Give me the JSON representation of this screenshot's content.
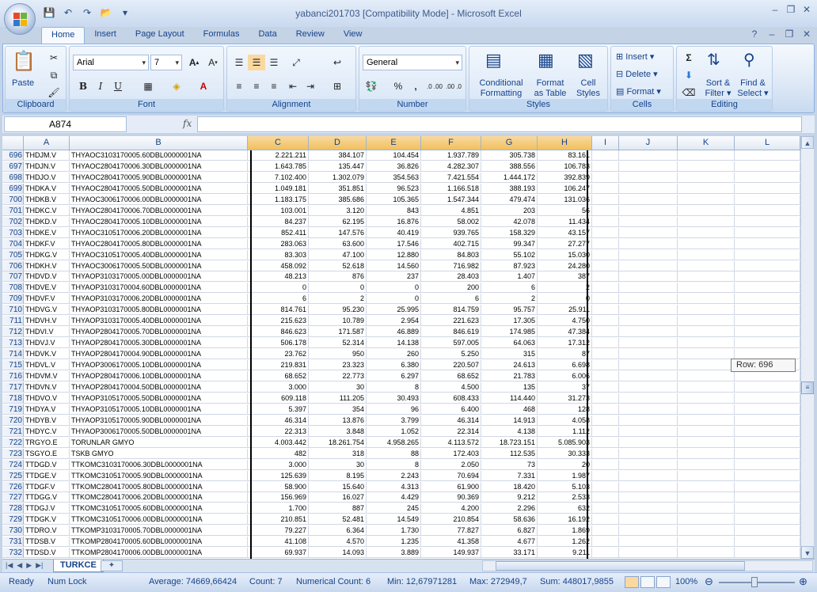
{
  "window": {
    "title": "yabanci201703  [Compatibility Mode] - Microsoft Excel",
    "controls": [
      "–",
      "❐",
      "✕"
    ]
  },
  "ribbon_tabs": [
    "Home",
    "Insert",
    "Page Layout",
    "Formulas",
    "Data",
    "Review",
    "View"
  ],
  "ribbon": {
    "clipboard": {
      "label": "Clipboard",
      "paste": "Paste"
    },
    "font": {
      "label": "Font",
      "name": "Arial",
      "size": "7",
      "bold": "B",
      "italic": "I",
      "underline": "U"
    },
    "alignment": {
      "label": "Alignment"
    },
    "number": {
      "label": "Number",
      "format": "General",
      "percent": "%",
      "comma": ",",
      "inc_dec": ".0 .00",
      "dec_dec": ".00 .0"
    },
    "styles": {
      "label": "Styles",
      "conditional": "Conditional",
      "conditional2": "Formatting",
      "format_table": "Format",
      "format_table2": "as Table",
      "cell_styles": "Cell",
      "cell_styles2": "Styles"
    },
    "cells": {
      "label": "Cells",
      "insert": "Insert",
      "delete": "Delete",
      "format": "Format"
    },
    "editing": {
      "label": "Editing",
      "sort": "Sort &",
      "sort2": "Filter",
      "find": "Find &",
      "find2": "Select"
    }
  },
  "formula_bar": {
    "name_box": "A874",
    "fx": "fx",
    "value": ""
  },
  "columns": [
    "A",
    "B",
    "C",
    "D",
    "E",
    "F",
    "G",
    "H",
    "I",
    "J",
    "K",
    "L"
  ],
  "rows": [
    {
      "n": "696",
      "a": "THDJM.V",
      "b": "THYAOC3103170005.60DBL0000001NA",
      "c": "2.221.211",
      "d": "384.107",
      "e": "104.454",
      "f": "1.937.789",
      "g": "305.738",
      "h": "83.161"
    },
    {
      "n": "697",
      "a": "THDJN.V",
      "b": "THYAOC2804170006.30DBL0000001NA",
      "c": "1.643.785",
      "d": "135.447",
      "e": "36.826",
      "f": "4.282.307",
      "g": "388.556",
      "h": "106.783"
    },
    {
      "n": "698",
      "a": "THDJO.V",
      "b": "THYAOC2804170005.90DBL0000001NA",
      "c": "7.102.400",
      "d": "1.302.079",
      "e": "354.563",
      "f": "7.421.554",
      "g": "1.444.172",
      "h": "392.839"
    },
    {
      "n": "699",
      "a": "THDKA.V",
      "b": "THYAOC2804170005.50DBL0000001NA",
      "c": "1.049.181",
      "d": "351.851",
      "e": "96.523",
      "f": "1.166.518",
      "g": "388.193",
      "h": "106.247"
    },
    {
      "n": "700",
      "a": "THDKB.V",
      "b": "THYAOC3006170006.00DBL0000001NA",
      "c": "1.183.175",
      "d": "385.686",
      "e": "105.365",
      "f": "1.547.344",
      "g": "479.474",
      "h": "131.036"
    },
    {
      "n": "701",
      "a": "THDKC.V",
      "b": "THYAOC2804170006.70DBL0000001NA",
      "c": "103.001",
      "d": "3.120",
      "e": "843",
      "f": "4.851",
      "g": "203",
      "h": "56"
    },
    {
      "n": "702",
      "a": "THDKD.V",
      "b": "THYAOC2804170005.10DBL0000001NA",
      "c": "84.237",
      "d": "62.195",
      "e": "16.876",
      "f": "58.002",
      "g": "42.078",
      "h": "11.434"
    },
    {
      "n": "703",
      "a": "THDKE.V",
      "b": "THYAOC3105170006.20DBL0000001NA",
      "c": "852.411",
      "d": "147.576",
      "e": "40.419",
      "f": "939.765",
      "g": "158.329",
      "h": "43.157"
    },
    {
      "n": "704",
      "a": "THDKF.V",
      "b": "THYAOC2804170005.80DBL0000001NA",
      "c": "283.063",
      "d": "63.600",
      "e": "17.546",
      "f": "402.715",
      "g": "99.347",
      "h": "27.277"
    },
    {
      "n": "705",
      "a": "THDKG.V",
      "b": "THYAOC3105170005.40DBL0000001NA",
      "c": "83.303",
      "d": "47.100",
      "e": "12.880",
      "f": "84.803",
      "g": "55.102",
      "h": "15.030"
    },
    {
      "n": "706",
      "a": "THDKH.V",
      "b": "THYAOC3006170005.50DBL0000001NA",
      "c": "458.092",
      "d": "52.618",
      "e": "14.560",
      "f": "716.982",
      "g": "87.923",
      "h": "24.280"
    },
    {
      "n": "707",
      "a": "THDVD.V",
      "b": "THYAOP3103170005.00DBL0000001NA",
      "c": "48.213",
      "d": "876",
      "e": "237",
      "f": "28.403",
      "g": "1.407",
      "h": "387"
    },
    {
      "n": "708",
      "a": "THDVE.V",
      "b": "THYAOP3103170004.60DBL0000001NA",
      "c": "0",
      "d": "0",
      "e": "0",
      "f": "200",
      "g": "6",
      "h": "2"
    },
    {
      "n": "709",
      "a": "THDVF.V",
      "b": "THYAOP3103170006.20DBL0000001NA",
      "c": "6",
      "d": "2",
      "e": "0",
      "f": "6",
      "g": "2",
      "h": "0"
    },
    {
      "n": "710",
      "a": "THDVG.V",
      "b": "THYAOP3103170005.80DBL0000001NA",
      "c": "814.761",
      "d": "95.230",
      "e": "25.995",
      "f": "814.759",
      "g": "95.757",
      "h": "25.911"
    },
    {
      "n": "711",
      "a": "THDVH.V",
      "b": "THYAOP3103170005.40DBL0000001NA",
      "c": "215.623",
      "d": "10.789",
      "e": "2.954",
      "f": "221.623",
      "g": "17.305",
      "h": "4.750"
    },
    {
      "n": "712",
      "a": "THDVI.V",
      "b": "THYAOP2804170005.70DBL0000001NA",
      "c": "846.623",
      "d": "171.587",
      "e": "46.889",
      "f": "846.619",
      "g": "174.985",
      "h": "47.384"
    },
    {
      "n": "713",
      "a": "THDVJ.V",
      "b": "THYAOP2804170005.30DBL0000001NA",
      "c": "506.178",
      "d": "52.314",
      "e": "14.138",
      "f": "597.005",
      "g": "64.063",
      "h": "17.312"
    },
    {
      "n": "714",
      "a": "THDVK.V",
      "b": "THYAOP2804170004.90DBL0000001NA",
      "c": "23.762",
      "d": "950",
      "e": "260",
      "f": "5.250",
      "g": "315",
      "h": "87"
    },
    {
      "n": "715",
      "a": "THDVL.V",
      "b": "THYAOP3006170005.10DBL0000001NA",
      "c": "219.831",
      "d": "23.323",
      "e": "6.380",
      "f": "220.507",
      "g": "24.613",
      "h": "6.698"
    },
    {
      "n": "716",
      "a": "THDVM.V",
      "b": "THYAOP2804170006.10DBL0000001NA",
      "c": "68.652",
      "d": "22.773",
      "e": "6.297",
      "f": "68.652",
      "g": "21.783",
      "h": "6.006"
    },
    {
      "n": "717",
      "a": "THDVN.V",
      "b": "THYAOP2804170004.50DBL0000001NA",
      "c": "3.000",
      "d": "30",
      "e": "8",
      "f": "4.500",
      "g": "135",
      "h": "37"
    },
    {
      "n": "718",
      "a": "THDVO.V",
      "b": "THYAOP3105170005.50DBL0000001NA",
      "c": "609.118",
      "d": "111.205",
      "e": "30.493",
      "f": "608.433",
      "g": "114.440",
      "h": "31.273"
    },
    {
      "n": "719",
      "a": "THDYA.V",
      "b": "THYAOP3105170005.10DBL0000001NA",
      "c": "5.397",
      "d": "354",
      "e": "96",
      "f": "6.400",
      "g": "468",
      "h": "128"
    },
    {
      "n": "720",
      "a": "THDYB.V",
      "b": "THYAOP3105170005.90DBL0000001NA",
      "c": "46.314",
      "d": "13.876",
      "e": "3.799",
      "f": "46.314",
      "g": "14.913",
      "h": "4.058"
    },
    {
      "n": "721",
      "a": "THDYC.V",
      "b": "THYAOP3006170005.50DBL0000001NA",
      "c": "22.313",
      "d": "3.848",
      "e": "1.052",
      "f": "22.314",
      "g": "4.138",
      "h": "1.112"
    },
    {
      "n": "722",
      "a": "TRGYO.E",
      "b": "TORUNLAR GMYO",
      "c": "4.003.442",
      "d": "18.261.754",
      "e": "4.958.265",
      "f": "4.113.572",
      "g": "18.723.151",
      "h": "5.085.903"
    },
    {
      "n": "723",
      "a": "TSGYO.E",
      "b": "TSKB GMYO",
      "c": "482",
      "d": "318",
      "e": "88",
      "f": "172.403",
      "g": "112.535",
      "h": "30.333"
    },
    {
      "n": "724",
      "a": "TTDGD.V",
      "b": "TTKOMC3103170006.30DBL0000001NA",
      "c": "3.000",
      "d": "30",
      "e": "8",
      "f": "2.050",
      "g": "73",
      "h": "20"
    },
    {
      "n": "725",
      "a": "TTDGE.V",
      "b": "TTKOMC3105170005.90DBL0000001NA",
      "c": "125.639",
      "d": "8.195",
      "e": "2.243",
      "f": "70.694",
      "g": "7.331",
      "h": "1.987"
    },
    {
      "n": "726",
      "a": "TTDGF.V",
      "b": "TTKOMC2804170005.80DBL0000001NA",
      "c": "58.900",
      "d": "15.640",
      "e": "4.313",
      "f": "61.900",
      "g": "18.420",
      "h": "5.103"
    },
    {
      "n": "727",
      "a": "TTDGG.V",
      "b": "TTKOMC2804170006.20DBL0000001NA",
      "c": "156.969",
      "d": "16.027",
      "e": "4.429",
      "f": "90.369",
      "g": "9.212",
      "h": "2.533"
    },
    {
      "n": "728",
      "a": "TTDGJ.V",
      "b": "TTKOMC3105170005.60DBL0000001NA",
      "c": "1.700",
      "d": "887",
      "e": "245",
      "f": "4.200",
      "g": "2.296",
      "h": "632"
    },
    {
      "n": "729",
      "a": "TTDGK.V",
      "b": "TTKOMC3105170006.00DBL0000001NA",
      "c": "210.851",
      "d": "52.481",
      "e": "14.549",
      "f": "210.854",
      "g": "58.636",
      "h": "16.192"
    },
    {
      "n": "730",
      "a": "TTDRO.V",
      "b": "TTKOMP3103170005.70DBL0000001NA",
      "c": "79.227",
      "d": "6.364",
      "e": "1.730",
      "f": "77.827",
      "g": "6.827",
      "h": "1.869"
    },
    {
      "n": "731",
      "a": "TTDSB.V",
      "b": "TTKOMP2804170005.60DBL0000001NA",
      "c": "41.108",
      "d": "4.570",
      "e": "1.235",
      "f": "41.358",
      "g": "4.677",
      "h": "1.262"
    },
    {
      "n": "732",
      "a": "TTDSD.V",
      "b": "TTKOMP2804170006.00DBL0000001NA",
      "c": "69.937",
      "d": "14.093",
      "e": "3.889",
      "f": "149.937",
      "g": "33.171",
      "h": "9.211"
    }
  ],
  "tooltip": "Row: 696",
  "sheet_tab": "TURKCE",
  "status": {
    "ready": "Ready",
    "num_lock": "Num Lock",
    "average": "Average: 74669,66424",
    "count": "Count: 7",
    "numerical_count": "Numerical Count: 6",
    "min": "Min: 12,67971281",
    "max": "Max: 272949,7",
    "sum": "Sum: 448017,9855",
    "zoom": "100%"
  }
}
